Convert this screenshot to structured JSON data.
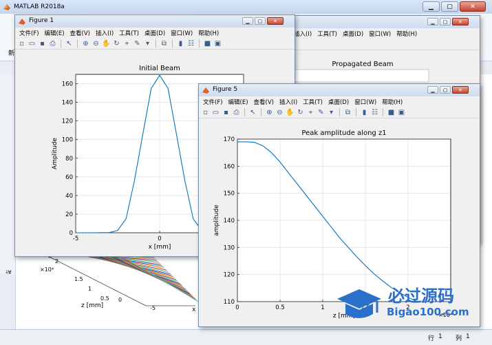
{
  "app": {
    "title": "MATLAB R2018a",
    "toolstrip_fragment": "新",
    "side_label": "详",
    "status": {
      "row_label": "行",
      "row_value": "1",
      "col_label": "列",
      "col_value": "1"
    }
  },
  "figure_menu": [
    "文件(F)",
    "编辑(E)",
    "查看(V)",
    "插入(I)",
    "工具(T)",
    "桌面(D)",
    "窗口(W)",
    "帮助(H)"
  ],
  "figure1": {
    "title": "Figure 1",
    "plot_title": "Initial Beam",
    "xlabel": "x [mm]",
    "ylabel": "Amplitude"
  },
  "figure_back": {
    "plot_title": "Propagated Beam",
    "surface_axis": {
      "zlabel": "z [mm]",
      "xlabel_fragment": "x",
      "exp": "×10⁴",
      "ticks": [
        "2",
        "1.5",
        "1",
        "0.5",
        "0"
      ],
      "xticks": [
        "-5"
      ]
    }
  },
  "figure5": {
    "title": "Figure 5",
    "plot_title": "Peak amplitude along z1",
    "xlabel": "z [mm]",
    "ylabel": "amplitude",
    "x_exponent": "×10⁴"
  },
  "watermark": {
    "text": "必过源码",
    "url": "Bigao100.com"
  },
  "chart_data": [
    {
      "type": "line",
      "title": "Initial Beam",
      "xlabel": "x [mm]",
      "ylabel": "Amplitude",
      "xlim": [
        -5,
        5
      ],
      "ylim": [
        0,
        170
      ],
      "xticks": [
        -5,
        0,
        5
      ],
      "yticks": [
        0,
        20,
        40,
        60,
        80,
        100,
        120,
        140,
        160
      ],
      "grid": true,
      "color": "#0072bd",
      "series": [
        {
          "x": [
            -5,
            -4,
            -3,
            -2.5,
            -2,
            -1.5,
            -1,
            -0.5,
            0,
            0.5,
            1,
            1.5,
            2,
            2.5,
            3
          ],
          "y": [
            0,
            0,
            0.2,
            2.5,
            15,
            56,
            106,
            155,
            169,
            155,
            106,
            56,
            15,
            2.5,
            0.2
          ]
        }
      ]
    },
    {
      "type": "line",
      "title": "Peak amplitude along z1",
      "xlabel": "z [mm]",
      "ylabel": "amplitude",
      "x_exponent": "×10⁴",
      "xlim": [
        0,
        2.5
      ],
      "ylim": [
        110,
        170
      ],
      "xticks": [
        0,
        0.5,
        1,
        1.5,
        2
      ],
      "yticks": [
        110,
        120,
        130,
        140,
        150,
        160,
        170
      ],
      "grid": true,
      "color": "#0072bd",
      "series": [
        {
          "x": [
            0,
            0.1,
            0.2,
            0.3,
            0.4,
            0.5,
            0.6,
            0.7,
            0.8,
            0.9,
            1.0,
            1.1,
            1.2,
            1.3,
            1.4,
            1.5,
            1.6,
            1.7,
            1.8,
            1.9,
            2.0,
            2.1
          ],
          "y": [
            169,
            169,
            168.8,
            167.5,
            165,
            161.5,
            157.5,
            153.5,
            149.5,
            145.5,
            141.5,
            137.5,
            133.5,
            130,
            126.5,
            123.3,
            120.3,
            117.7,
            115.3,
            113.3,
            111.6,
            110
          ]
        }
      ]
    }
  ]
}
